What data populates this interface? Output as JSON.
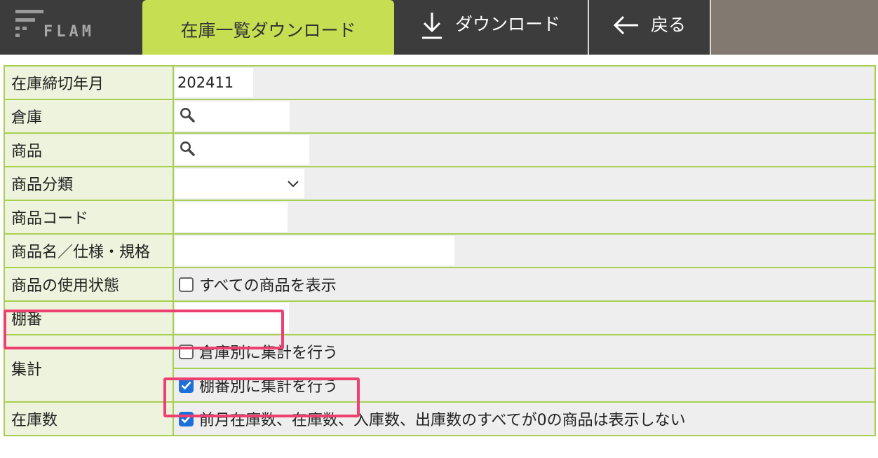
{
  "header": {
    "logo_text": "FLAM",
    "title": "在庫一覧ダウンロード",
    "download_label": "ダウンロード",
    "back_label": "戻る"
  },
  "form": {
    "closing_month": {
      "label": "在庫締切年月",
      "value": "202411"
    },
    "warehouse": {
      "label": "倉庫",
      "icon": "search-icon"
    },
    "product": {
      "label": "商品",
      "icon": "search-icon"
    },
    "category": {
      "label": "商品分類",
      "value": ""
    },
    "product_code": {
      "label": "商品コード",
      "value": ""
    },
    "product_name": {
      "label": "商品名／仕様・規格",
      "value": ""
    },
    "usage_status": {
      "label": "商品の使用状態",
      "checkbox_label": "すべての商品を表示",
      "checked": false
    },
    "shelf_no": {
      "label": "棚番",
      "value": ""
    },
    "aggregate": {
      "label": "集計",
      "by_warehouse": {
        "label": "倉庫別に集計を行う",
        "checked": false
      },
      "by_shelf": {
        "label": "棚番別に集計を行う",
        "checked": true
      }
    },
    "stock_qty": {
      "label": "在庫数",
      "checkbox_label": "前月在庫数、在庫数、入庫数、出庫数のすべてが0の商品は表示しない",
      "checked": true
    }
  },
  "colors": {
    "accent": "#c6df52",
    "header_bg": "#3c3c3c",
    "border": "#a9cf52",
    "highlight": "#ee3f71",
    "checkbox": "#1e6fd9"
  }
}
